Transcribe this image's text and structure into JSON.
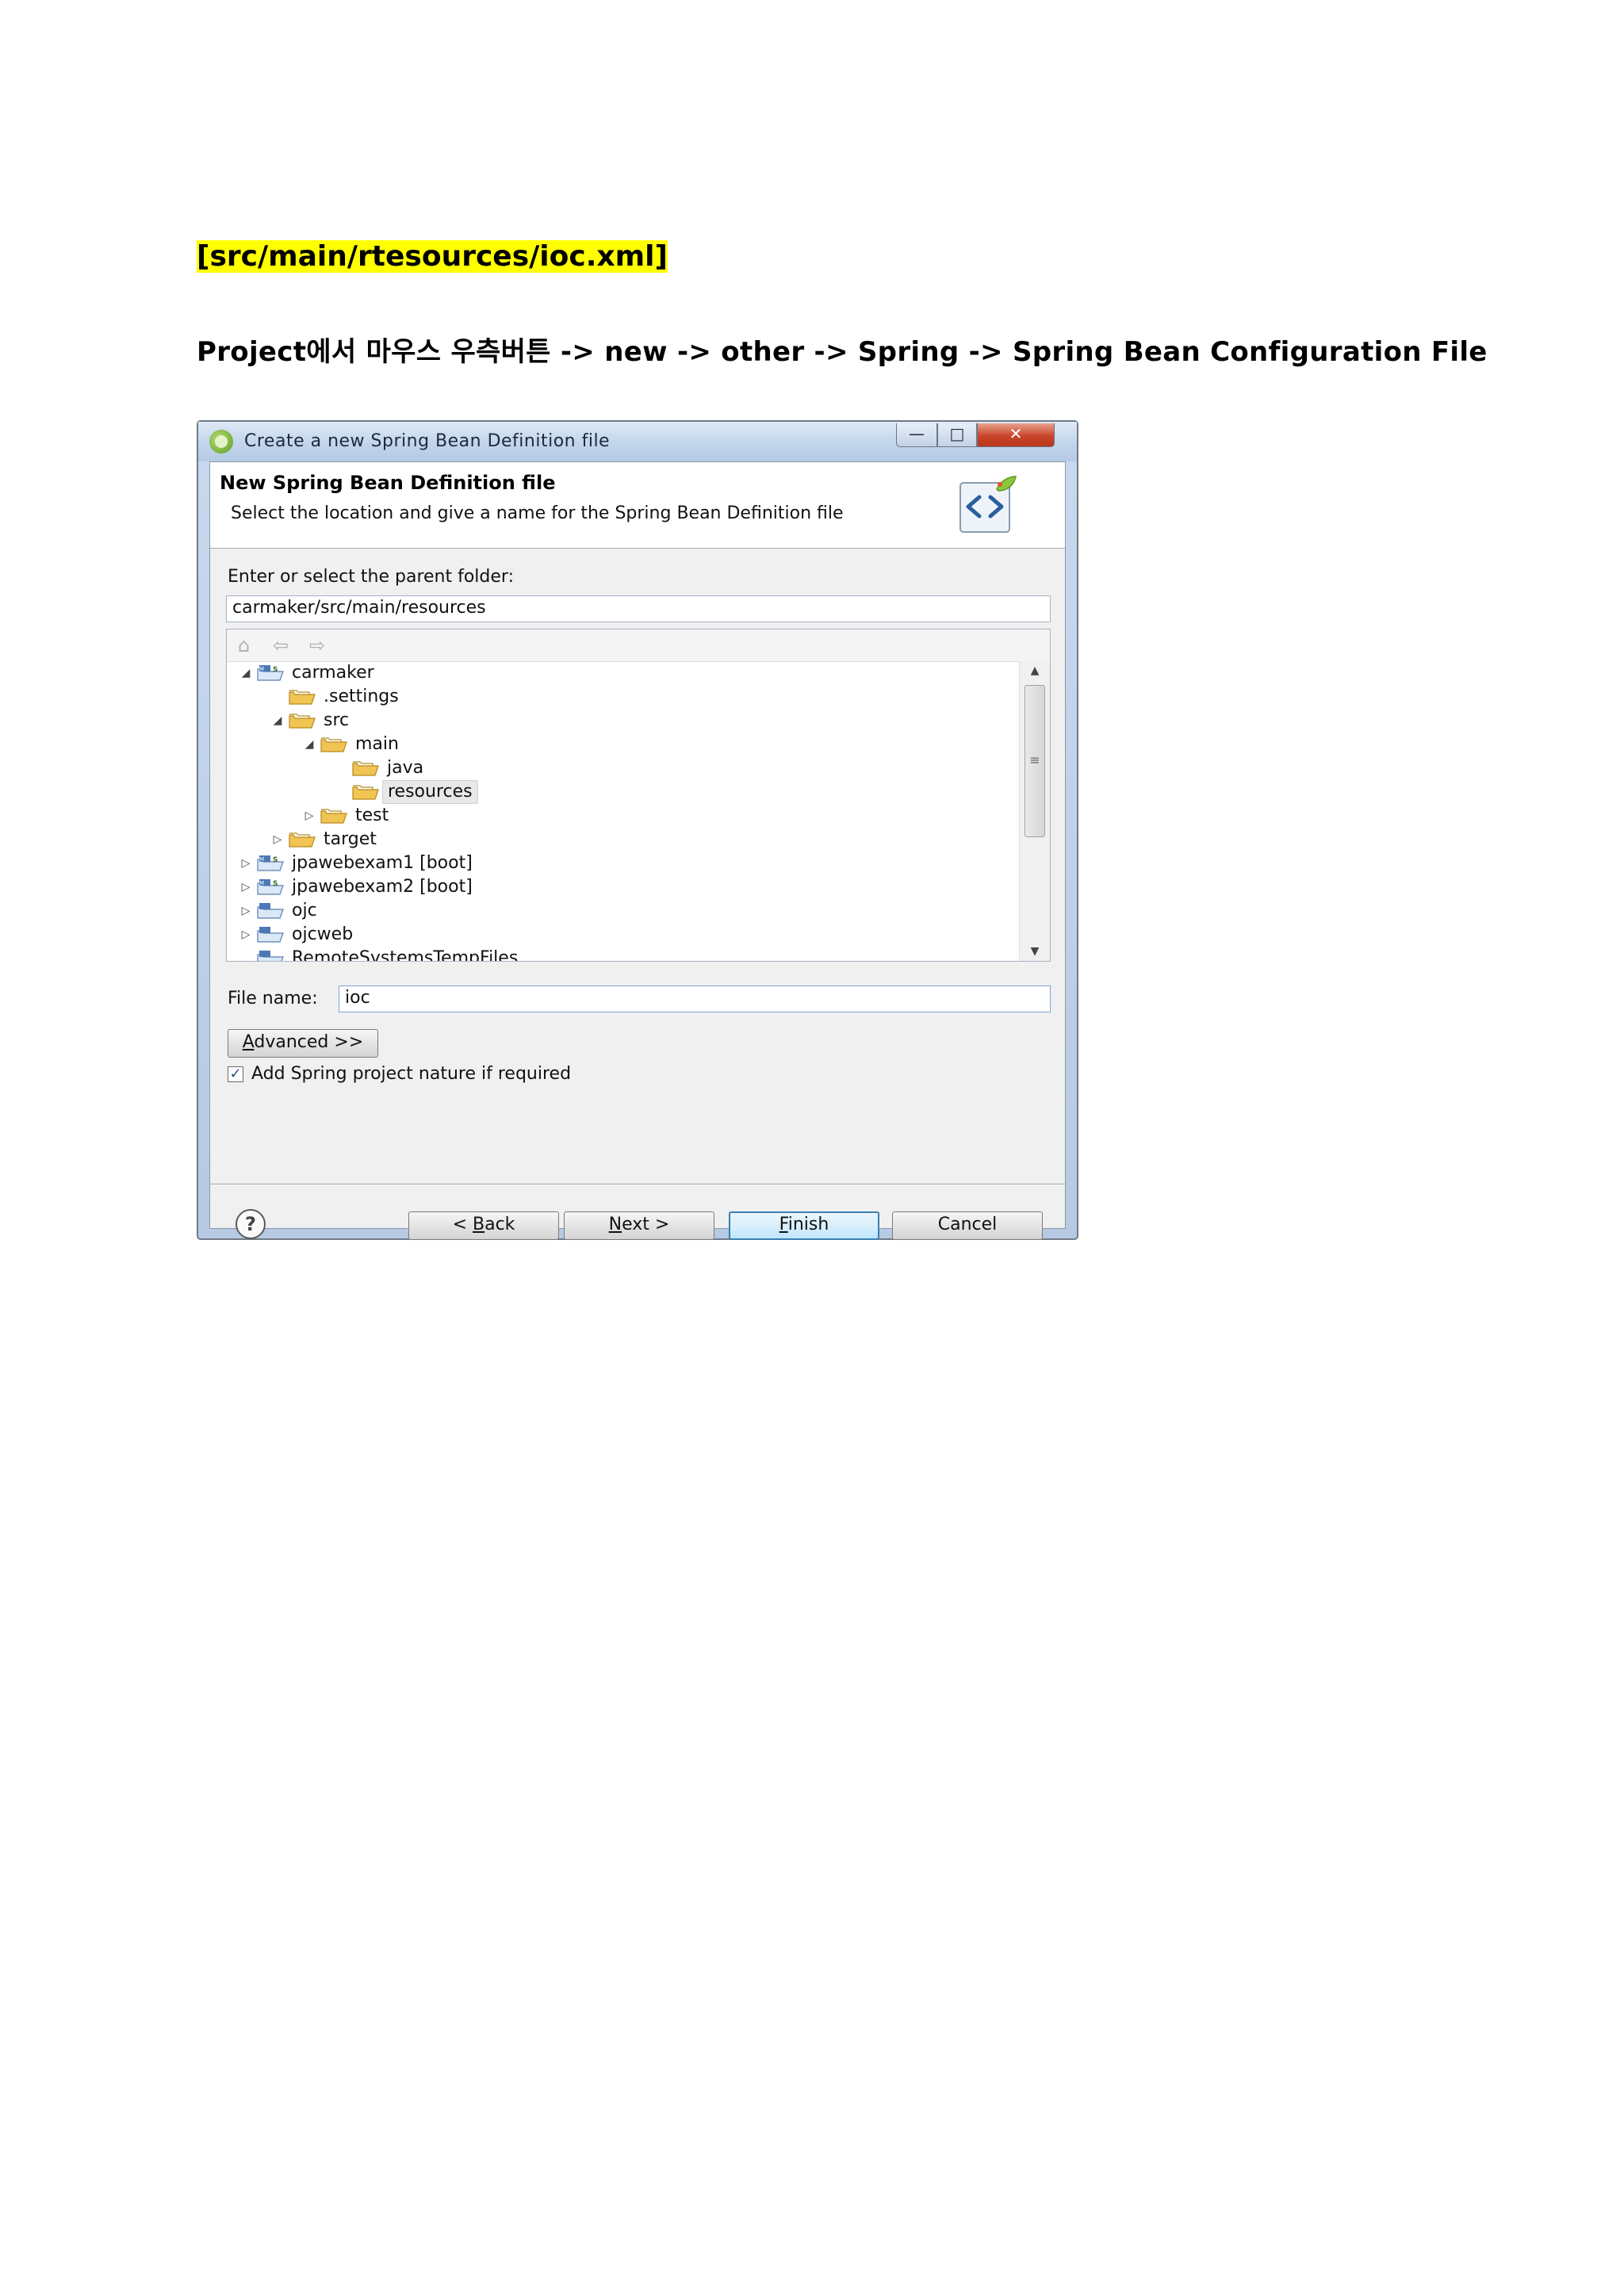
{
  "document": {
    "heading": "[src/main/rtesources/ioc.xml]",
    "instruction": "Project에서 마우스 우측버튼 -> new -> other -> Spring -> Spring Bean Configuration File"
  },
  "dialog": {
    "title": "Create a new Spring Bean Definition file",
    "window_buttons": {
      "minimize": "—",
      "maximize": "□",
      "close": "✕"
    },
    "banner": {
      "title": "New Spring Bean Definition file",
      "description": "Select the location and give a name for the Spring Bean Definition file"
    },
    "parent_folder": {
      "label": "Enter or select the parent folder:",
      "value": "carmaker/src/main/resources"
    },
    "tree": {
      "rows": [
        {
          "label": "carmaker",
          "twisty": "expanded",
          "icon": "maven-spring-project-icon",
          "depth": 0
        },
        {
          "label": ".settings",
          "twisty": "none",
          "icon": "folder-icon",
          "depth": 1
        },
        {
          "label": "src",
          "twisty": "expanded",
          "icon": "folder-icon",
          "depth": 1
        },
        {
          "label": "main",
          "twisty": "expanded",
          "icon": "folder-icon",
          "depth": 2
        },
        {
          "label": "java",
          "twisty": "none",
          "icon": "folder-icon",
          "depth": 3
        },
        {
          "label": "resources",
          "twisty": "none",
          "icon": "folder-icon",
          "depth": 3,
          "selected": true
        },
        {
          "label": "test",
          "twisty": "collapsed",
          "icon": "folder-icon",
          "depth": 2
        },
        {
          "label": "target",
          "twisty": "collapsed",
          "icon": "folder-icon",
          "depth": 1
        },
        {
          "label": "jpawebexam1 [boot]",
          "twisty": "collapsed",
          "icon": "maven-spring-project-icon",
          "depth": 0
        },
        {
          "label": "jpawebexam2 [boot]",
          "twisty": "collapsed",
          "icon": "maven-spring-project-icon",
          "depth": 0
        },
        {
          "label": "ojc",
          "twisty": "collapsed",
          "icon": "project-icon",
          "depth": 0
        },
        {
          "label": "ojcweb",
          "twisty": "collapsed",
          "icon": "project-icon",
          "depth": 0
        },
        {
          "label": "RemoteSystemsTempFiles",
          "twisty": "none",
          "icon": "open-project-icon",
          "depth": 0
        }
      ]
    },
    "file_name": {
      "label": "File name:",
      "value": "ioc"
    },
    "advanced_button": {
      "mnemonic": "A",
      "rest": "dvanced >>"
    },
    "nature_checkbox": {
      "label": "Add Spring project nature if required",
      "checked": "✓"
    },
    "help_glyph": "?",
    "buttons": {
      "back": {
        "prefix": "< ",
        "mnemonic": "B",
        "rest": "ack"
      },
      "next": {
        "mnemonic": "N",
        "rest": "ext >"
      },
      "finish": {
        "mnemonic": "F",
        "rest": "inish"
      },
      "cancel": "Cancel"
    },
    "colors": {
      "highlight": "#ffff00",
      "folder": "#f2c453",
      "default_button_border": "#3c7fb1",
      "close_button": "#c8452a"
    }
  }
}
